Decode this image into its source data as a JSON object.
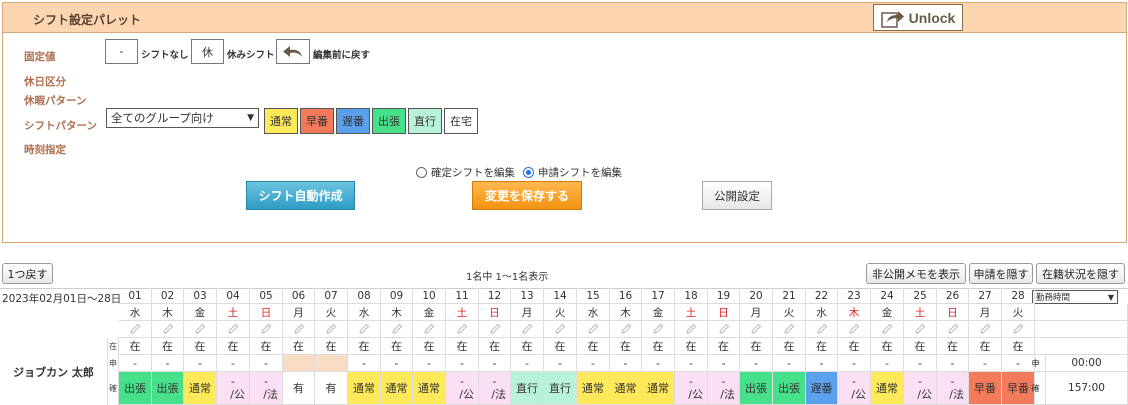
{
  "palette": {
    "title": "シフト設定パレット",
    "unlock_label": "Unlock",
    "labels": {
      "fixed": "固定値",
      "holiday_type": "休日区分",
      "leave_pattern": "休暇パターン",
      "shift_pattern": "シフトパターン",
      "time_spec": "時刻指定"
    },
    "fixed_values": [
      {
        "symbol": "-",
        "caption": "シフトなし"
      },
      {
        "symbol": "休",
        "caption": "休みシフト"
      }
    ],
    "undo_caption": "編集前に戻す",
    "group_select": "全てのグループ向け",
    "patterns": [
      {
        "label": "通常",
        "color": "#fde95a"
      },
      {
        "label": "早番",
        "color": "#f37a5a"
      },
      {
        "label": "遅番",
        "color": "#5aa0ec"
      },
      {
        "label": "出張",
        "color": "#47e08a"
      },
      {
        "label": "直行",
        "color": "#b8f2d8"
      },
      {
        "label": "在宅",
        "color": "#ffffff"
      }
    ],
    "radio": {
      "confirmed": "確定シフトを編集",
      "requested": "申請シフトを編集"
    },
    "btn_auto": "シフト自動作成",
    "btn_save": "変更を保存する",
    "btn_publish": "公開設定"
  },
  "toolbar": {
    "back": "1つ戻す",
    "count": "1名中 1〜1名表示",
    "show_private_memo": "非公開メモを表示",
    "hide_request": "申請を隠す",
    "hide_status": "在籍状況を隠す"
  },
  "grid": {
    "range": "2023年02月01日〜28日",
    "kind_select": "勤務時間",
    "employee": "ジョブカン 太郎",
    "row_tags": [
      "在",
      "申",
      "確"
    ],
    "summary_tags": [
      "申",
      "確"
    ],
    "summary_values": [
      "00:00",
      "157:00"
    ],
    "days": [
      {
        "d": "01",
        "w": "水",
        "status": "在",
        "req": "-",
        "shift": "出張"
      },
      {
        "d": "02",
        "w": "木",
        "status": "在",
        "req": "-",
        "shift": "出張"
      },
      {
        "d": "03",
        "w": "金",
        "status": "在",
        "req": "-",
        "shift": "通常"
      },
      {
        "d": "04",
        "w": "土",
        "status": "在",
        "req": "-",
        "shift": "-\n/公"
      },
      {
        "d": "05",
        "w": "日",
        "status": "在",
        "req": "-",
        "shift": "-\n/法"
      },
      {
        "d": "06",
        "w": "月",
        "status": "在",
        "req": "",
        "shift": "有"
      },
      {
        "d": "07",
        "w": "火",
        "status": "在",
        "req": "",
        "shift": "有"
      },
      {
        "d": "08",
        "w": "水",
        "status": "在",
        "req": "-",
        "shift": "通常"
      },
      {
        "d": "09",
        "w": "木",
        "status": "在",
        "req": "-",
        "shift": "通常"
      },
      {
        "d": "10",
        "w": "金",
        "status": "在",
        "req": "-",
        "shift": "通常"
      },
      {
        "d": "11",
        "w": "土",
        "status": "在",
        "req": "-",
        "shift": "-\n/公"
      },
      {
        "d": "12",
        "w": "日",
        "status": "在",
        "req": "-",
        "shift": "-\n/法"
      },
      {
        "d": "13",
        "w": "月",
        "status": "在",
        "req": "-",
        "shift": "直行"
      },
      {
        "d": "14",
        "w": "火",
        "status": "在",
        "req": "-",
        "shift": "直行"
      },
      {
        "d": "15",
        "w": "水",
        "status": "在",
        "req": "-",
        "shift": "通常"
      },
      {
        "d": "16",
        "w": "木",
        "status": "在",
        "req": "-",
        "shift": "通常"
      },
      {
        "d": "17",
        "w": "金",
        "status": "在",
        "req": "-",
        "shift": "通常"
      },
      {
        "d": "18",
        "w": "土",
        "status": "在",
        "req": "-",
        "shift": "-\n/公"
      },
      {
        "d": "19",
        "w": "日",
        "status": "在",
        "req": "-",
        "shift": "-\n/法"
      },
      {
        "d": "20",
        "w": "月",
        "status": "在",
        "req": "-",
        "shift": "出張"
      },
      {
        "d": "21",
        "w": "火",
        "status": "在",
        "req": "-",
        "shift": "出張"
      },
      {
        "d": "22",
        "w": "水",
        "status": "在",
        "req": "-",
        "shift": "遅番"
      },
      {
        "d": "23",
        "w": "木",
        "status": "在",
        "req": "-",
        "shift": "-\n/公"
      },
      {
        "d": "24",
        "w": "金",
        "status": "在",
        "req": "-",
        "shift": "通常"
      },
      {
        "d": "25",
        "w": "土",
        "status": "在",
        "req": "-",
        "shift": "-\n/公"
      },
      {
        "d": "26",
        "w": "日",
        "status": "在",
        "req": "-",
        "shift": "-\n/法"
      },
      {
        "d": "27",
        "w": "月",
        "status": "在",
        "req": "-",
        "shift": "早番"
      },
      {
        "d": "28",
        "w": "火",
        "status": "在",
        "req": "-",
        "shift": "早番"
      }
    ],
    "holiday_weekdays": [
      "土",
      "日"
    ],
    "extra_red_days": [
      "23"
    ],
    "shift_colors": {
      "出張": "#47e08a",
      "通常": "#fde95a",
      "直行": "#b8f2d8",
      "遅番": "#5aa0ec",
      "早番": "#f37a5a",
      "off": "#fbe0f5",
      "有": "#ffffff",
      "req_highlight": "#f8dcc4"
    }
  }
}
